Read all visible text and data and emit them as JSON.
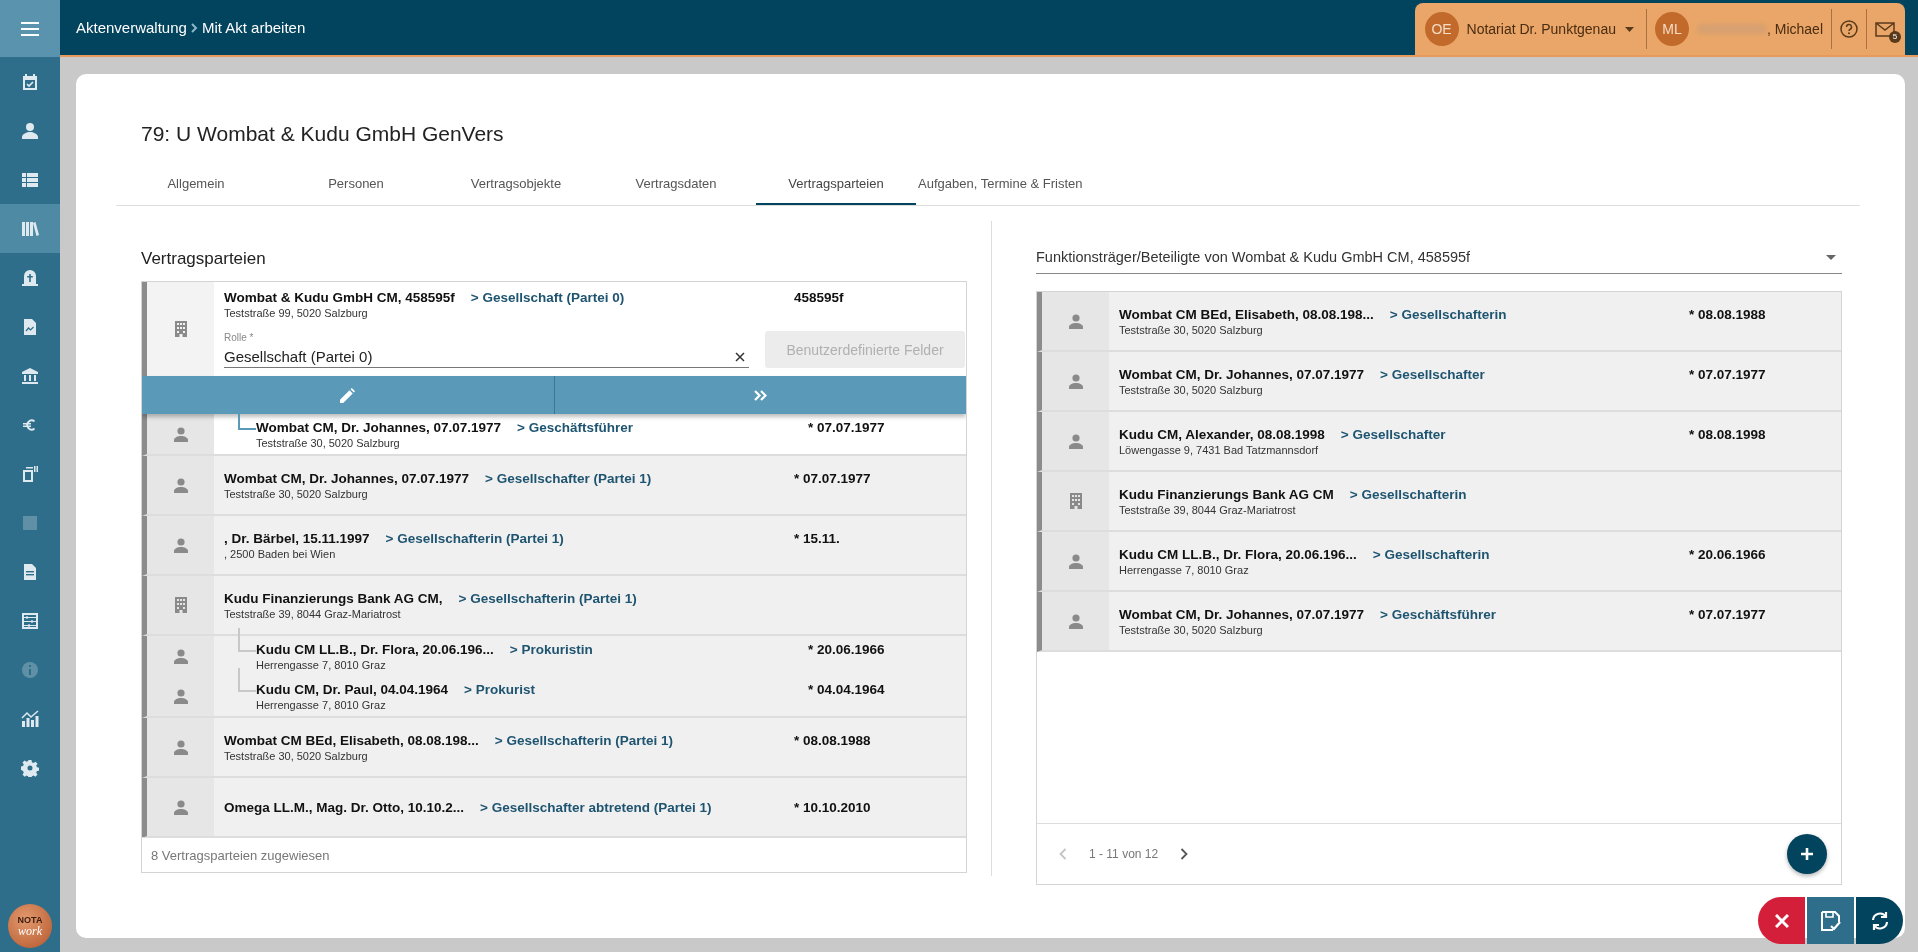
{
  "app_bar": {
    "breadcrumb": [
      {
        "label": "Aktenverwaltung"
      },
      {
        "label": "Mit Akt arbeiten"
      }
    ],
    "office": {
      "initials": "OE",
      "name": "Notariat Dr. Punktgenau"
    },
    "user": {
      "initials": "ML",
      "name": ", Michael"
    },
    "mail_count": "5"
  },
  "sidebar": {
    "items": [
      {
        "selected": false,
        "disabled": false
      },
      {
        "selected": false,
        "disabled": false
      },
      {
        "selected": false,
        "disabled": false
      },
      {
        "selected": true,
        "disabled": false
      },
      {
        "selected": false,
        "disabled": false
      },
      {
        "selected": false,
        "disabled": false
      },
      {
        "selected": false,
        "disabled": false
      },
      {
        "selected": false,
        "disabled": false
      },
      {
        "selected": false,
        "disabled": false
      },
      {
        "selected": false,
        "disabled": true
      },
      {
        "selected": false,
        "disabled": false
      },
      {
        "selected": false,
        "disabled": false
      },
      {
        "selected": false,
        "disabled": true
      },
      {
        "selected": false,
        "disabled": false
      },
      {
        "selected": false,
        "disabled": false
      }
    ],
    "logo": {
      "line1": "NOTA",
      "line2": "work"
    }
  },
  "file": {
    "title": "79: U Wombat & Kudu GmbH GenVers"
  },
  "tabs": [
    {
      "label": "Allgemein",
      "selected": false
    },
    {
      "label": "Personen",
      "selected": false
    },
    {
      "label": "Vertragsobjekte",
      "selected": false
    },
    {
      "label": "Vertragsdaten",
      "selected": false
    },
    {
      "label": "Vertragsparteien",
      "selected": true
    },
    {
      "label": "Aufgaben, Termine & Fristen",
      "selected": false
    }
  ],
  "parties_panel": {
    "heading": "Vertragsparteien",
    "parties": [
      {
        "kind": "company",
        "name": "Wombat & Kudu GmbH CM, 458595f",
        "role": "> Gesellschaft (Partei 0)",
        "date": "458595f",
        "address": "Teststraße 99, 5020 Salzburg",
        "selected": true,
        "role_field": {
          "label": "Rolle *",
          "value": "Gesellschaft (Partei 0)"
        },
        "custom_fields_button": {
          "label": "Benutzerdefinierte Felder",
          "disabled": true
        },
        "children": [
          {
            "kind": "person",
            "name": "Wombat CM, Dr. Johannes, 07.07.1977",
            "role": "> Geschäftsführer",
            "date": "* 07.07.1977",
            "address": "Teststraße 30, 5020 Salzburg"
          }
        ]
      },
      {
        "kind": "person",
        "name": "Wombat CM, Dr. Johannes, 07.07.1977",
        "role": "> Gesellschafter (Partei 1)",
        "date": "* 07.07.1977",
        "address": "Teststraße 30, 5020 Salzburg",
        "selected": false
      },
      {
        "kind": "person",
        "name": ", Dr. Bärbel, 15.11.1997",
        "role": "> Gesellschafterin (Partei 1)",
        "date": "* 15.11.",
        "address": ", 2500 Baden bei Wien",
        "selected": false
      },
      {
        "kind": "company",
        "name": "Kudu Finanzierungs Bank AG CM,",
        "role": "> Gesellschafterin (Partei 1)",
        "address": "Teststraße 39, 8044 Graz-Mariatrost",
        "selected": false,
        "children": [
          {
            "kind": "person",
            "name": "Kudu CM LL.B., Dr. Flora, 20.06.196...",
            "role": "> Prokuristin",
            "date": "* 20.06.1966",
            "address": "Herrengasse 7, 8010 Graz"
          },
          {
            "kind": "person",
            "name": "Kudu CM, Dr. Paul, 04.04.1964",
            "role": "> Prokurist",
            "date": "* 04.04.1964",
            "address": "Herrengasse 7, 8010 Graz"
          }
        ]
      },
      {
        "kind": "person",
        "name": "Wombat CM BEd, Elisabeth, 08.08.198...",
        "role": "> Gesellschafterin (Partei 1)",
        "date": "* 08.08.1988",
        "address": "Teststraße 30, 5020 Salzburg",
        "selected": false
      },
      {
        "kind": "person",
        "name": "Omega LL.M., Mag. Dr. Otto, 10.10.2...",
        "role": "> Gesellschafter abtretend (Partei 1)",
        "date": "* 10.10.2010",
        "selected": false
      }
    ],
    "footer": "8 Vertragsparteien zugewiesen"
  },
  "participants_panel": {
    "selector": {
      "value": "Funktionsträger/Beteiligte von Wombat & Kudu GmbH CM, 458595f"
    },
    "rows": [
      {
        "kind": "person",
        "name": "Wombat CM BEd, Elisabeth, 08.08.198...",
        "role": "> Gesellschafterin",
        "date": "* 08.08.1988",
        "address": "Teststraße 30, 5020 Salzburg"
      },
      {
        "kind": "person",
        "name": "Wombat CM, Dr. Johannes, 07.07.1977",
        "role": "> Gesellschafter",
        "date": "* 07.07.1977",
        "address": "Teststraße 30, 5020 Salzburg"
      },
      {
        "kind": "person",
        "name": "Kudu CM, Alexander, 08.08.1998",
        "role": "> Gesellschafter",
        "date": "* 08.08.1998",
        "address": "Löwengasse 9, 7431 Bad Tatzmannsdorf"
      },
      {
        "kind": "company",
        "name": "Kudu Finanzierungs Bank AG CM",
        "role": "> Gesellschafterin",
        "address": "Teststraße 39, 8044 Graz-Mariatrost"
      },
      {
        "kind": "person",
        "name": "Kudu CM LL.B., Dr. Flora, 20.06.196...",
        "role": "> Gesellschafterin",
        "date": "* 20.06.1966",
        "address": "Herrengasse 7, 8010 Graz"
      },
      {
        "kind": "person",
        "name": "Wombat CM, Dr. Johannes, 07.07.1977",
        "role": "> Geschäftsführer",
        "date": "* 07.07.1977",
        "address": "Teststraße 30, 5020 Salzburg"
      }
    ],
    "pagination": {
      "range": "1 - 11 von 12"
    }
  }
}
